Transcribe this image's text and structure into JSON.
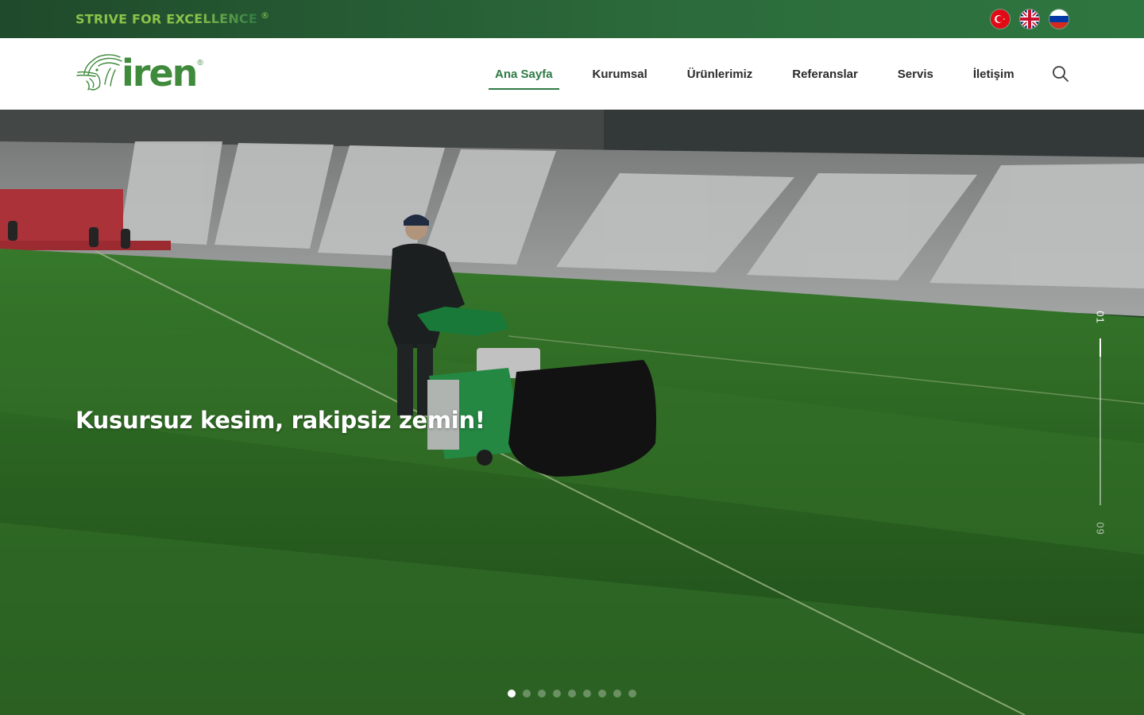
{
  "topbar": {
    "tagline_part1": "STRIVE FOR EXC",
    "tagline_part2": "ELLENCE",
    "tagline_mark": "®",
    "languages": [
      {
        "code": "tr",
        "icon": "turkey-flag-icon"
      },
      {
        "code": "en",
        "icon": "uk-flag-icon"
      },
      {
        "code": "ru",
        "icon": "russia-flag-icon"
      }
    ],
    "colors": {
      "bar": "#2c6b3b",
      "tagline": "#8bc34a"
    }
  },
  "header": {
    "logo_text": "iren",
    "logo_mark": "®",
    "nav": [
      {
        "label": "Ana Sayfa",
        "active": true
      },
      {
        "label": "Kurumsal",
        "active": false
      },
      {
        "label": "Ürünlerimiz",
        "active": false
      },
      {
        "label": "Referanslar",
        "active": false
      },
      {
        "label": "Servis",
        "active": false
      },
      {
        "label": "İletişim",
        "active": false
      }
    ],
    "search_icon": "search-icon",
    "accent": "#2f7a45"
  },
  "hero": {
    "title": "Kusursuz kesim, rakipsiz zemin!",
    "slide_current": "01",
    "slide_total": "09",
    "slide_count": 9,
    "active_slide": 1,
    "image_alt": "stadium-mower-scene"
  }
}
